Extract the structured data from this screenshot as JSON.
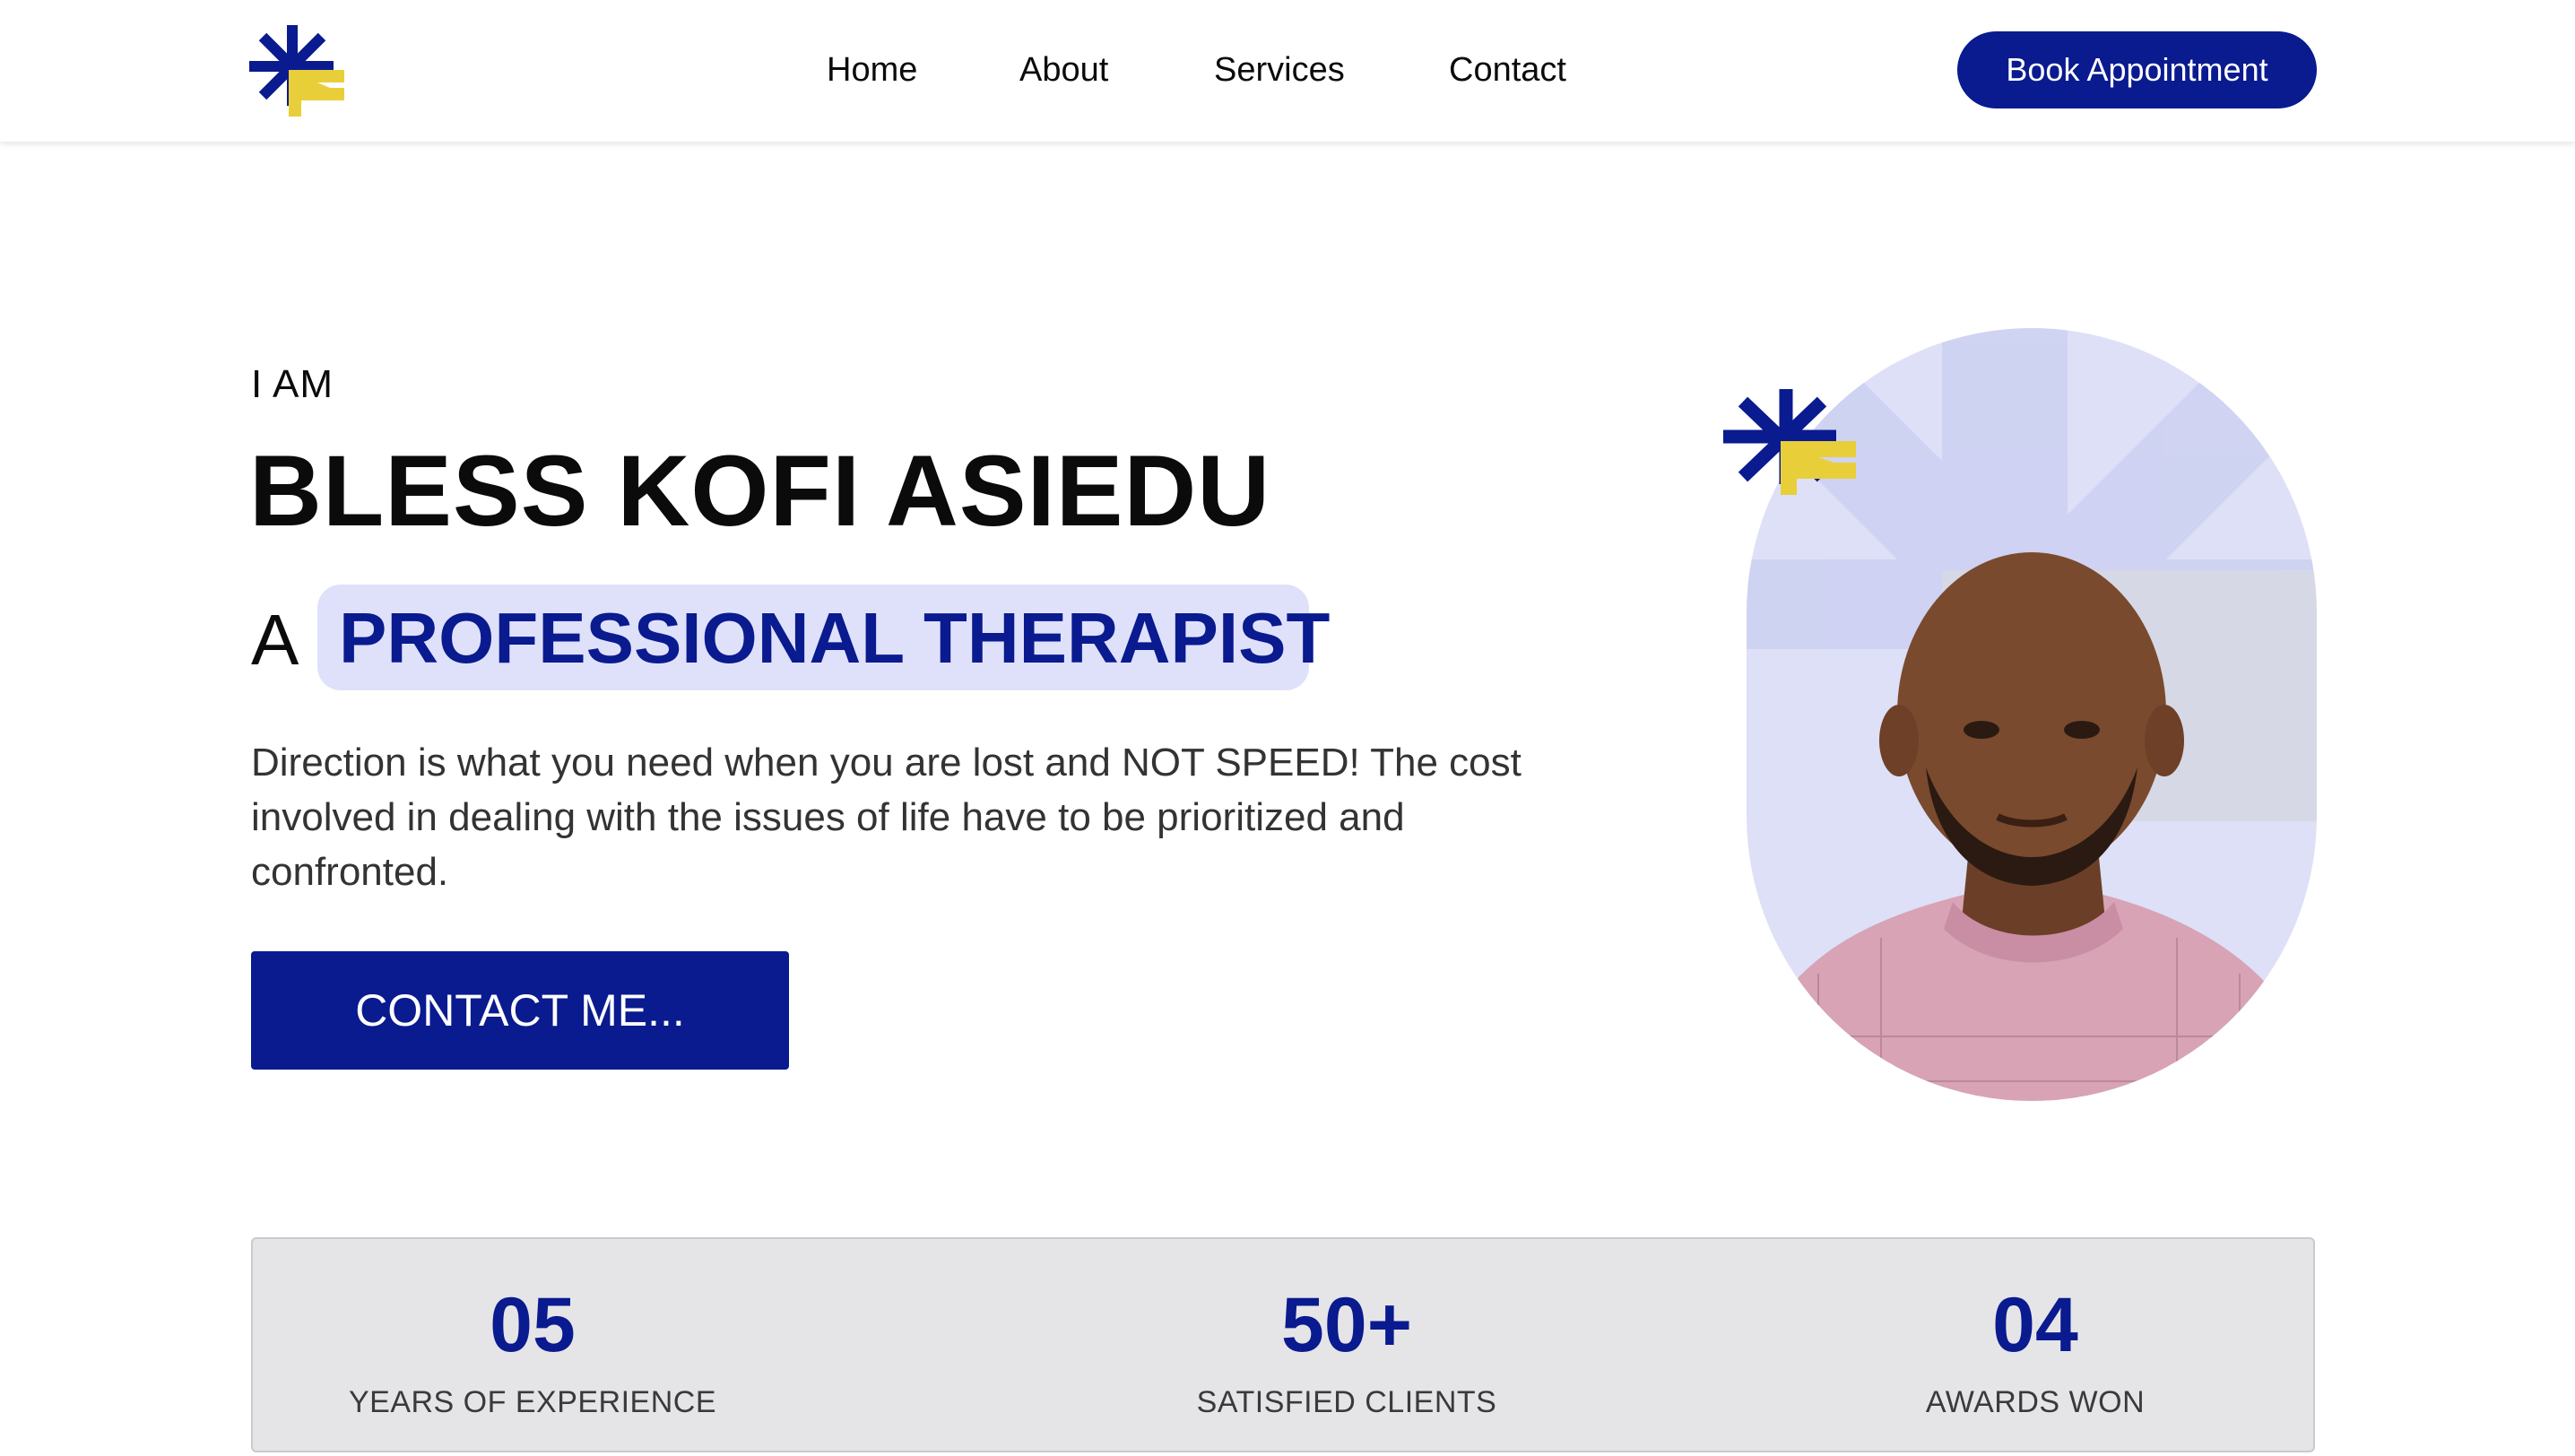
{
  "colors": {
    "brand_navy": "#0a1a8f",
    "brand_yellow": "#e8cf3a",
    "highlight_bg": "#dfe1fa",
    "stats_bg": "#e5e5e8"
  },
  "header": {
    "logo_icon": "asterisk-flag-logo",
    "nav": {
      "home": "Home",
      "about": "About",
      "services": "Services",
      "contact": "Contact"
    },
    "book_button": "Book Appointment"
  },
  "hero": {
    "eyebrow": "I AM",
    "name": "BLESS KOFI ASIEDU",
    "role_prefix": "A",
    "role_highlight": "PROFESSIONAL THERAPIST",
    "tagline": "Direction is what you need when you are lost and NOT SPEED! The cost involved in dealing with the issues of life have to be prioritized and confronted.",
    "contact_button": "CONTACT ME...",
    "portrait_icon": "therapist-portrait"
  },
  "stats": [
    {
      "value": "05",
      "label": "YEARS OF EXPERIENCE"
    },
    {
      "value": "50+",
      "label": "SATISFIED CLIENTS"
    },
    {
      "value": "04",
      "label": "AWARDS WON"
    }
  ]
}
